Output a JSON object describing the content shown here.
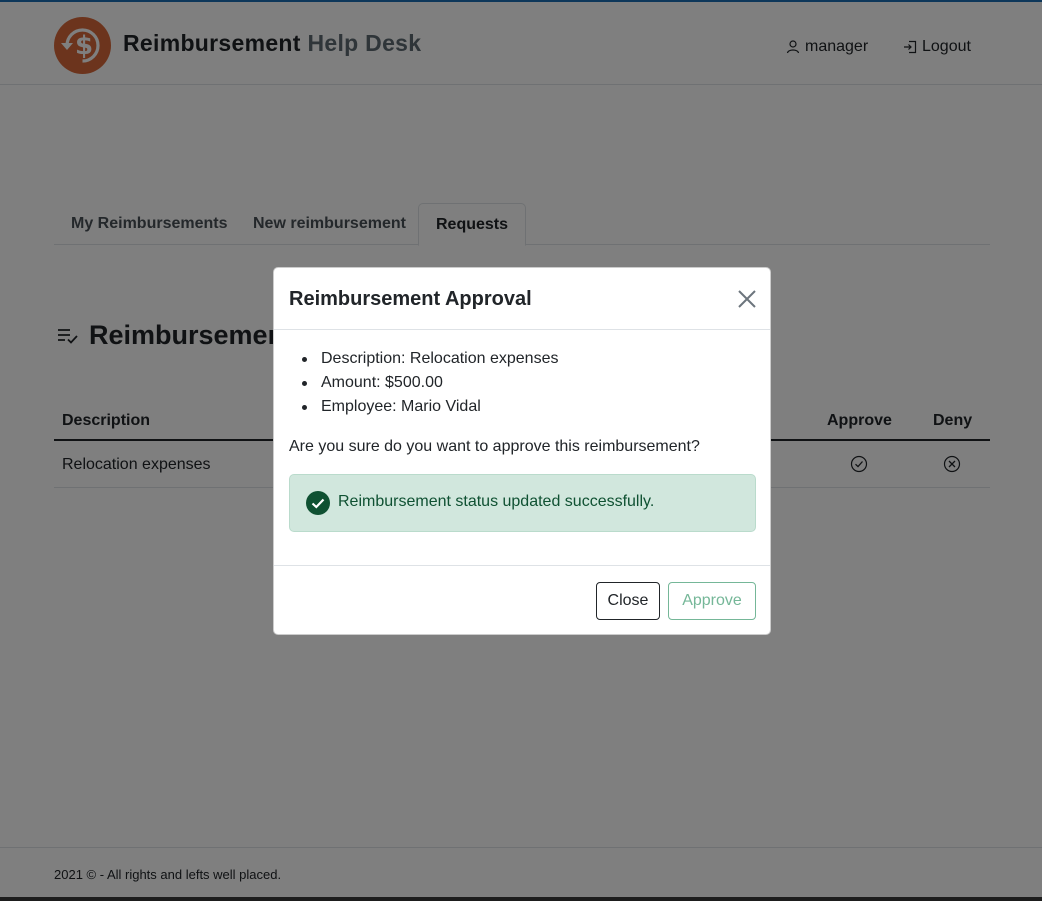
{
  "header": {
    "brand_primary": "Reimbursement",
    "brand_secondary": "Help Desk",
    "user_label": "manager",
    "logout_label": "Logout",
    "logo_color": "#d9693a"
  },
  "tabs": [
    {
      "label": "My Reimbursements",
      "active": false
    },
    {
      "label": "New reimbursement",
      "active": false
    },
    {
      "label": "Requests",
      "active": true
    }
  ],
  "section": {
    "title": "Reimbursements"
  },
  "table": {
    "headers": {
      "description": "Description",
      "approve": "Approve",
      "deny": "Deny"
    },
    "rows": [
      {
        "description": "Relocation expenses"
      }
    ]
  },
  "footer": {
    "text": "2021 © - All rights and lefts well placed."
  },
  "modal": {
    "title": "Reimbursement Approval",
    "details": [
      "Description: Relocation expenses",
      "Amount: $500.00",
      "Employee: Mario Vidal"
    ],
    "confirm_text": "Are you sure do you want to approve this reimbursement?",
    "alert_text": "Reimbursement status updated successfully.",
    "close_label": "Close",
    "approve_label": "Approve",
    "alert_bg": "#d1e7dd",
    "alert_fg": "#0f5132"
  }
}
